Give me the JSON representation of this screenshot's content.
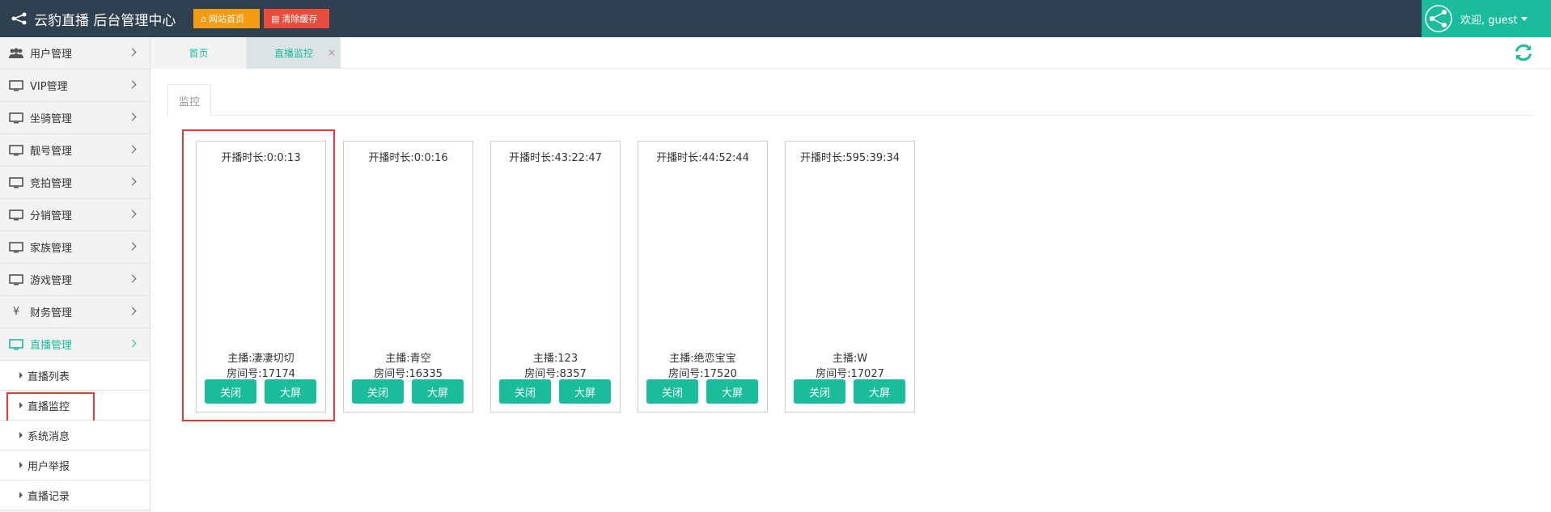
{
  "header": {
    "title": "云豹直播 后台管理中心",
    "btn_home": "网站首页",
    "btn_clear": "清除缓存",
    "welcome": "欢迎, guest"
  },
  "sidebar": {
    "items": [
      {
        "label": "用户管理",
        "icon": "users-icon"
      },
      {
        "label": "VIP管理",
        "icon": "monitor-icon"
      },
      {
        "label": "坐骑管理",
        "icon": "monitor-icon"
      },
      {
        "label": "靓号管理",
        "icon": "monitor-icon"
      },
      {
        "label": "竞拍管理",
        "icon": "monitor-icon"
      },
      {
        "label": "分销管理",
        "icon": "monitor-icon"
      },
      {
        "label": "家族管理",
        "icon": "monitor-icon"
      },
      {
        "label": "游戏管理",
        "icon": "monitor-icon"
      },
      {
        "label": "财务管理",
        "icon": "yen-icon"
      },
      {
        "label": "直播管理",
        "icon": "monitor-icon"
      }
    ],
    "sub_items": [
      "直播列表",
      "直播监控",
      "系统消息",
      "用户举报",
      "直播记录"
    ]
  },
  "tabs": {
    "home": "首页",
    "monitor": "直播监控",
    "close": "×"
  },
  "panel": {
    "tab_label": "监控"
  },
  "cards": [
    {
      "duration": "开播时长:0:0:13",
      "host": "主播:凄凄切切",
      "room": "房间号:17174",
      "close_label": "关闭",
      "big_label": "大屏"
    },
    {
      "duration": "开播时长:0:0:16",
      "host": "主播:青空",
      "room": "房间号:16335",
      "close_label": "关闭",
      "big_label": "大屏"
    },
    {
      "duration": "开播时长:43:22:47",
      "host": "主播:123",
      "room": "房间号:8357",
      "close_label": "关闭",
      "big_label": "大屏"
    },
    {
      "duration": "开播时长:44:52:44",
      "host": "主播:绝恋宝宝",
      "room": "房间号:17520",
      "close_label": "关闭",
      "big_label": "大屏"
    },
    {
      "duration": "开播时长:595:39:34",
      "host": "主播:W",
      "room": "房间号:17027",
      "close_label": "关闭",
      "big_label": "大屏"
    }
  ],
  "colors": {
    "topbar": "#2f4050",
    "accent": "#1abc9c",
    "warning": "#f39c12",
    "danger": "#e74c3c",
    "highlight": "#e53935"
  }
}
